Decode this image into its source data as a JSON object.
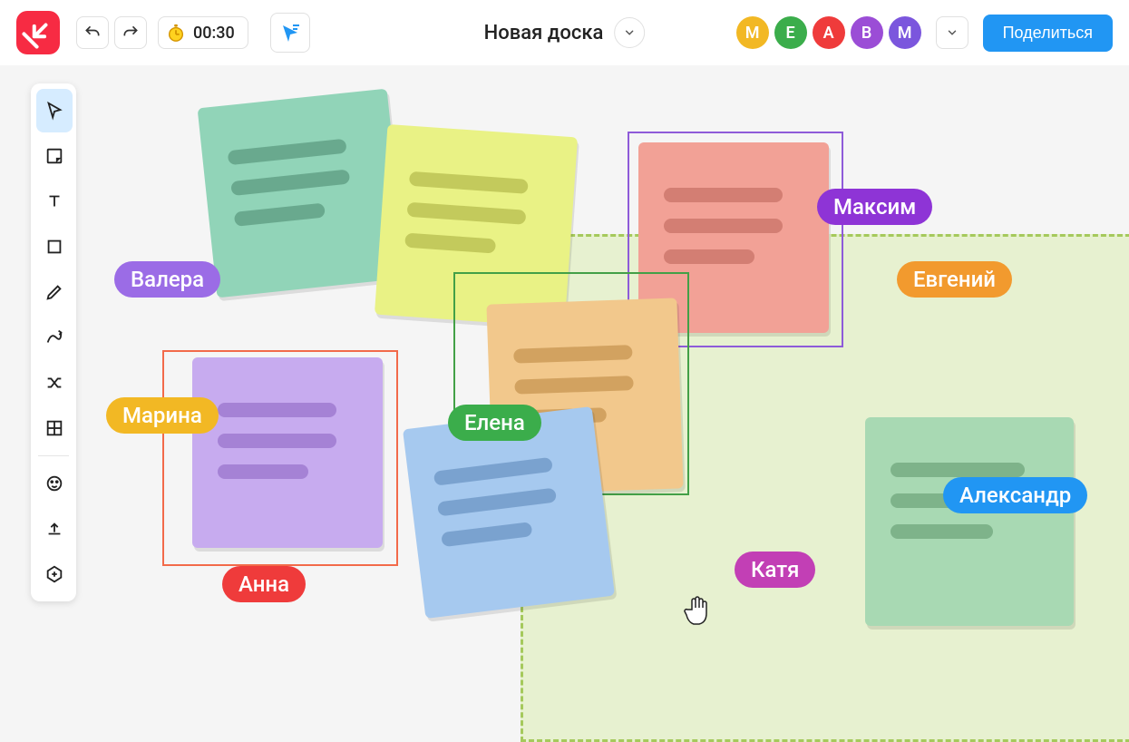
{
  "header": {
    "timer": "00:30",
    "board_title": "Новая доска",
    "share_label": "Поделиться"
  },
  "avatars": [
    {
      "letter": "М",
      "color": "#f2b824"
    },
    {
      "letter": "Е",
      "color": "#3bad4b"
    },
    {
      "letter": "А",
      "color": "#ef3b3b"
    },
    {
      "letter": "В",
      "color": "#9b4dd6"
    },
    {
      "letter": "М",
      "color": "#7b56dd"
    }
  ],
  "users": {
    "valera": {
      "name": "Валера",
      "color": "#9b6ce6"
    },
    "marina": {
      "name": "Марина",
      "color": "#f2b824"
    },
    "anna": {
      "name": "Анна",
      "color": "#ef3b3b"
    },
    "elena": {
      "name": "Елена",
      "color": "#3bad4b"
    },
    "maksim": {
      "name": "Максим",
      "color": "#8e34d6"
    },
    "evgeniy": {
      "name": "Евгений",
      "color": "#f29a2e"
    },
    "katya": {
      "name": "Катя",
      "color": "#c23fb5"
    },
    "aleksandr": {
      "name": "Александр",
      "color": "#2196f3"
    }
  },
  "sticky_colors": {
    "teal": "#91d4b8",
    "yellow": "#e9f285",
    "salmon": "#f2a196",
    "violet": "#c7abef",
    "orange": "#f2c88c",
    "blue": "#a6c9ef",
    "green": "#a8d9b3"
  },
  "tools": [
    {
      "id": "select",
      "name": "select-tool",
      "active": true
    },
    {
      "id": "sticky",
      "name": "sticky-tool"
    },
    {
      "id": "text",
      "name": "text-tool"
    },
    {
      "id": "shape",
      "name": "shape-tool"
    },
    {
      "id": "pen",
      "name": "pen-tool"
    },
    {
      "id": "connector",
      "name": "connector-tool"
    },
    {
      "id": "shuffle",
      "name": "shuffle-tool"
    },
    {
      "id": "frame",
      "name": "frame-tool"
    }
  ],
  "tools2": [
    {
      "id": "reaction",
      "name": "reaction-tool"
    },
    {
      "id": "upload",
      "name": "upload-tool"
    },
    {
      "id": "add",
      "name": "add-tool"
    }
  ]
}
